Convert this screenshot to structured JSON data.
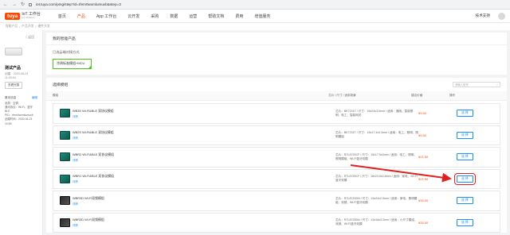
{
  "browser": {
    "url": "iot.tuya.com/pmg/step?id=rfem0wxmlumuxb&step=3"
  },
  "topnav": {
    "logo_mark": "tuya",
    "logo_text": "IoT 工作台",
    "logo_sub": "IoT Platform",
    "menu": [
      "首页",
      "产品",
      "App 工作台",
      "云开发",
      "采购",
      "数据",
      "运营",
      "帮助文档",
      "费用",
      "增值服务"
    ],
    "active_index": 1,
    "tech_support": "技术支持"
  },
  "breadcrumb": [
    "智能产品",
    "产品开发",
    "硬件开发"
  ],
  "sidebar": {
    "back": "〈 返回",
    "product_name": "测试产品",
    "created": "创建：2020-06-23 11:03:54",
    "edit_btn": "查看完整",
    "basic_info": "基本信息",
    "edit_link": "编辑",
    "lines": [
      "品类：空调",
      "通讯协议：Wi-Fi、蓝牙BLE",
      "PID：rfem0wxmlumuxb",
      "创建时间：2020-06-23 10:59"
    ]
  },
  "top_panel": {
    "title": "我的智能产品",
    "label": "已选云端对接方式",
    "chip": "涂鸦标准模组+MCU"
  },
  "select": {
    "title": "选择模组",
    "search_placeholder": "请输入型号",
    "columns": [
      "模组",
      "芯片 / 尺寸 / 适用场景",
      "建议价格",
      "操作"
    ]
  },
  "modules": [
    {
      "name": "WB3S Wi-Fi&BLE 双协议模组",
      "detail": "详情",
      "spec": "芯片：BK7231T / 尺寸：16x24x3.5mm / 适用：通用、智能照明、电工、智能网关",
      "price": "¥9.50",
      "action": "选 择",
      "img": "green"
    },
    {
      "name": "WB2S Wi-Fi&BLE 双协议模组",
      "detail": "详情",
      "spec": "芯片：BK7231T / 尺寸：15x17.3x3.3mm / 适用：电工、照明、照明模组",
      "price": "¥9.50",
      "action": "选 择",
      "img": "green"
    },
    {
      "name": "WBR2 Wi-Fi&BLE 双协议模组",
      "detail": "详情",
      "spec": "芯片：RTL8720CF / 尺寸：15x17.5x3mm / 适用：电工、照明、照明模组、Wi-Fi蓝牙双模",
      "price": "¥21.50",
      "action": "选 择",
      "img": "green"
    },
    {
      "name": "WBR1 Wi-Fi&BLE 双协议模组",
      "detail": "详情",
      "spec": "芯片：RTL8720CF / 尺寸：18x23.5x2.8mm / 适用：家电、Wi-Fi蓝牙双模",
      "price": "¥21.50",
      "action": "选 择",
      "img": "green",
      "highlight": true
    },
    {
      "name": "WBR3D Wi-Fi双频模组",
      "detail": "详情",
      "spec": "芯片：RTL8720DN / 尺寸：16x24x2.5mm / 适用：家电、照明模组、双频、Wi-Fi蓝牙双模",
      "price": "¥34.00",
      "action": "选 择",
      "img": "dark"
    },
    {
      "name": "WBR3D Wi-Fi双频模组",
      "detail": "详情",
      "spec": "芯片：RTL8720DN / 尺寸：15x18x3.3mm / 适用：小尺寸模组、双频、Wi-Fi蓝牙双模",
      "price": "¥34.00",
      "action": "选 择",
      "img": "dark"
    }
  ],
  "colors": {
    "accent": "#ff4800",
    "link": "#1890ff",
    "highlight": "#e02020",
    "chip_border": "#52c41a"
  }
}
